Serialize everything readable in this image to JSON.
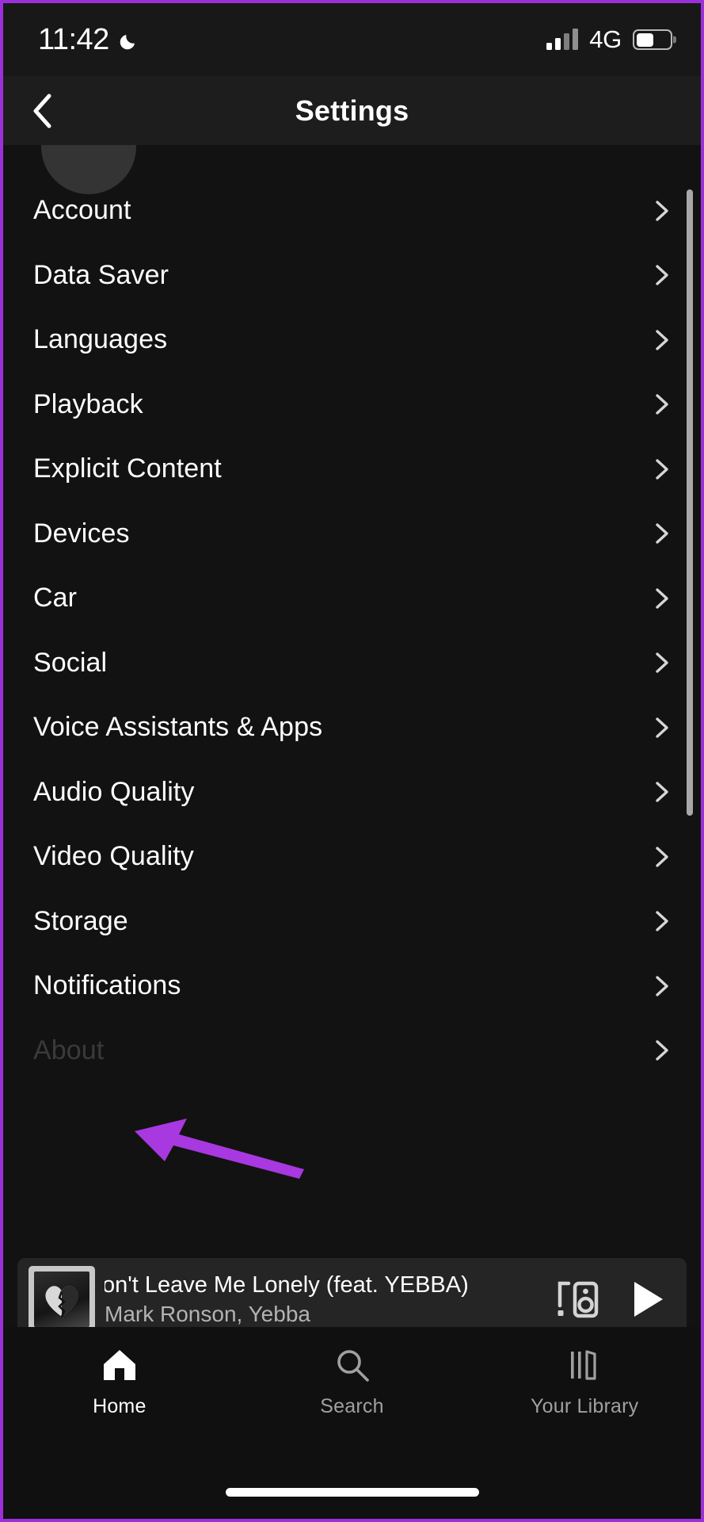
{
  "status_bar": {
    "time": "11:42",
    "moon_icon": "crescent-moon-icon",
    "network": "4G",
    "signal_icon": "cellular-signal-icon",
    "battery_icon": "battery-icon",
    "battery_level_pct": 52
  },
  "nav": {
    "title": "Settings",
    "back_icon": "chevron-left-icon"
  },
  "settings_list": {
    "chevron_icon": "chevron-right-icon",
    "items": [
      {
        "label": "Account"
      },
      {
        "label": "Data Saver"
      },
      {
        "label": "Languages"
      },
      {
        "label": "Playback"
      },
      {
        "label": "Explicit Content"
      },
      {
        "label": "Devices"
      },
      {
        "label": "Car"
      },
      {
        "label": "Social"
      },
      {
        "label": "Voice Assistants & Apps"
      },
      {
        "label": "Audio Quality"
      },
      {
        "label": "Video Quality"
      },
      {
        "label": "Storage"
      },
      {
        "label": "Notifications"
      },
      {
        "label": "About"
      }
    ]
  },
  "annotation": {
    "type": "arrow",
    "color": "#a838e0",
    "points_to": "Storage"
  },
  "now_playing": {
    "title": "Don't Leave Me Lonely (feat. YEBBA)",
    "artist": "Mark Ronson, Yebba",
    "album_art": "broken-heart-album-art",
    "connect_icon": "connect-to-device-icon",
    "play_icon": "play-icon",
    "progress_pct": 1
  },
  "tab_bar": {
    "tabs": [
      {
        "label": "Home",
        "icon": "home-icon",
        "active": true
      },
      {
        "label": "Search",
        "icon": "search-icon",
        "active": false
      },
      {
        "label": "Your Library",
        "icon": "library-icon",
        "active": false
      }
    ]
  },
  "theme": {
    "background": "#121212",
    "surface": "#252525",
    "accent": "#a838e0",
    "text_primary": "#ffffff",
    "text_secondary": "#b3b3b3"
  }
}
